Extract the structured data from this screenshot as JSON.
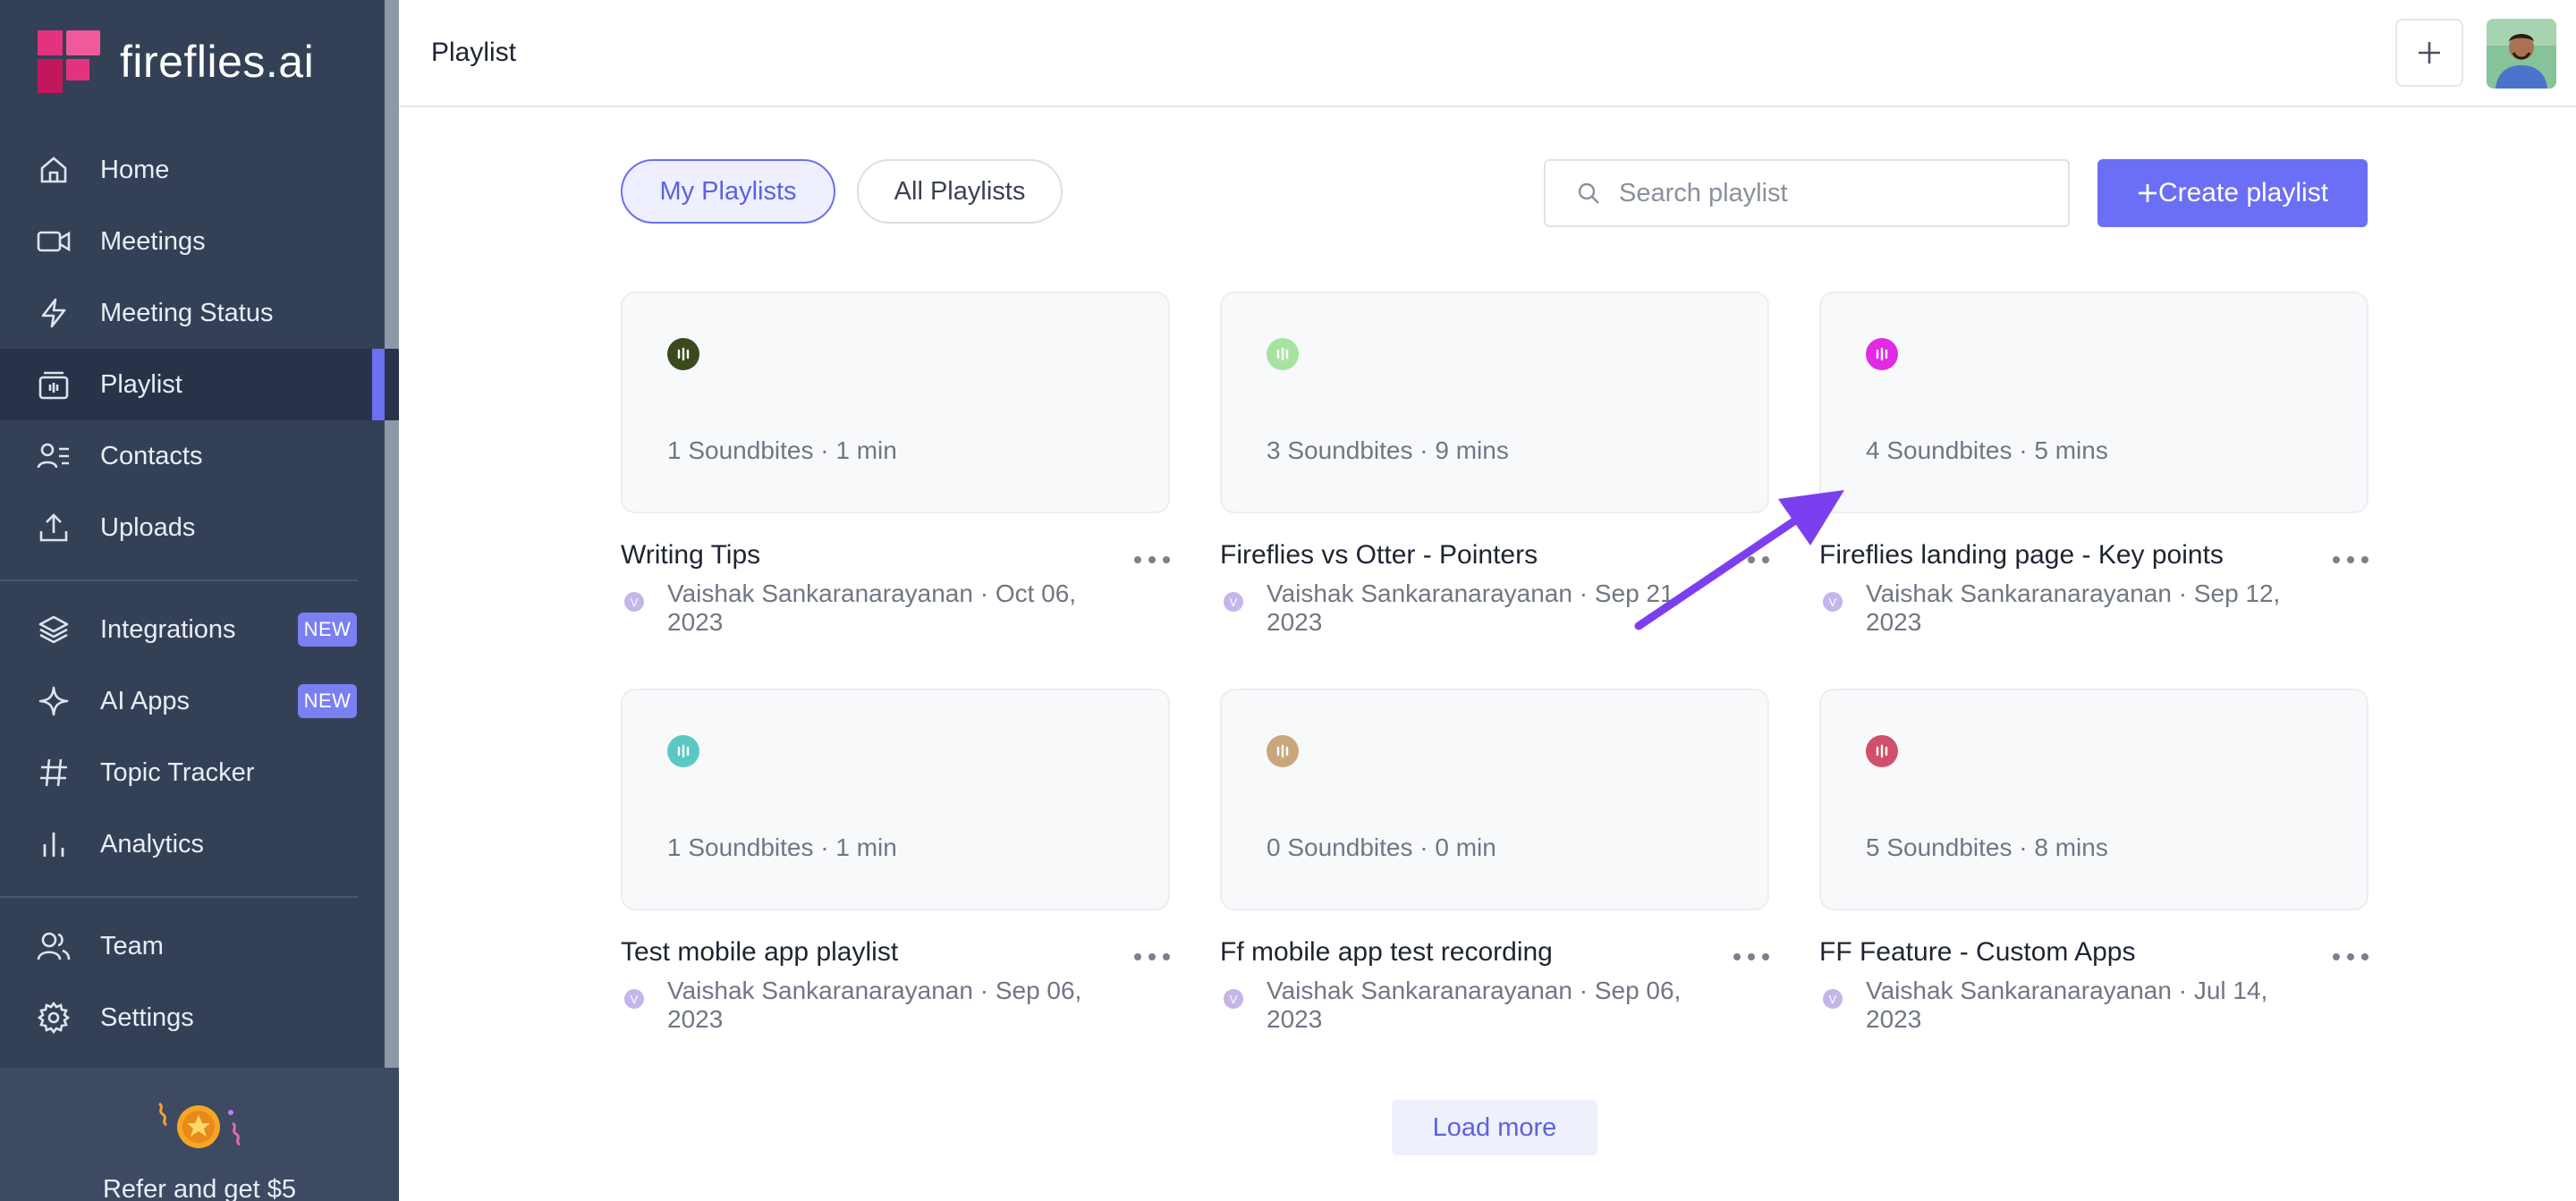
{
  "app": {
    "name": "fireflies.ai"
  },
  "sidebar": {
    "items": [
      {
        "label": "Home",
        "icon": "home-icon"
      },
      {
        "label": "Meetings",
        "icon": "video-icon"
      },
      {
        "label": "Meeting Status",
        "icon": "lightning-icon"
      },
      {
        "label": "Playlist",
        "icon": "playlist-icon",
        "active": true
      },
      {
        "label": "Contacts",
        "icon": "contacts-icon"
      },
      {
        "label": "Uploads",
        "icon": "upload-icon"
      },
      {
        "label": "Integrations",
        "icon": "layers-icon",
        "badge": "NEW"
      },
      {
        "label": "AI Apps",
        "icon": "sparkle-icon",
        "badge": "NEW"
      },
      {
        "label": "Topic Tracker",
        "icon": "hash-icon"
      },
      {
        "label": "Analytics",
        "icon": "bar-chart-icon"
      },
      {
        "label": "Team",
        "icon": "team-icon"
      },
      {
        "label": "Settings",
        "icon": "gear-icon"
      }
    ],
    "refer_label": "Refer and get $5"
  },
  "header": {
    "title": "Playlist"
  },
  "tabs": [
    {
      "label": "My Playlists",
      "active": true
    },
    {
      "label": "All Playlists",
      "active": false
    }
  ],
  "search": {
    "placeholder": "Search playlist"
  },
  "create_button": {
    "label": "Create playlist"
  },
  "playlists": [
    {
      "title": "Writing Tips",
      "meta": "1 Soundbites · 1 min",
      "owner_initial": "V",
      "owner": "Vaishak Sankaranarayanan · Oct 06, 2023",
      "icon_color": "#3b4a1c"
    },
    {
      "title": "Fireflies vs Otter - Pointers",
      "meta": "3 Soundbites · 9 mins",
      "owner_initial": "V",
      "owner": "Vaishak Sankaranarayanan · Sep 21, 2023",
      "icon_color": "#a6e3a1"
    },
    {
      "title": "Fireflies landing page - Key points",
      "meta": "4 Soundbites · 5 mins",
      "owner_initial": "V",
      "owner": "Vaishak Sankaranarayanan · Sep 12, 2023",
      "icon_color": "#e22ae6"
    },
    {
      "title": "Test mobile app playlist",
      "meta": "1 Soundbites · 1 min",
      "owner_initial": "V",
      "owner": "Vaishak Sankaranarayanan · Sep 06, 2023",
      "icon_color": "#5cc8c2"
    },
    {
      "title": "Ff mobile app test recording",
      "meta": "0 Soundbites · 0 min",
      "owner_initial": "V",
      "owner": "Vaishak Sankaranarayanan · Sep 06, 2023",
      "icon_color": "#c9a77d"
    },
    {
      "title": "FF Feature - Custom Apps",
      "meta": "5 Soundbites · 8 mins",
      "owner_initial": "V",
      "owner": "Vaishak Sankaranarayanan · Jul 14, 2023",
      "icon_color": "#d0506b"
    }
  ],
  "load_more": {
    "label": "Load more"
  },
  "colors": {
    "sidebar": "#344056",
    "accent": "#6b6ff5",
    "annotation_arrow": "#7b3ff0"
  }
}
